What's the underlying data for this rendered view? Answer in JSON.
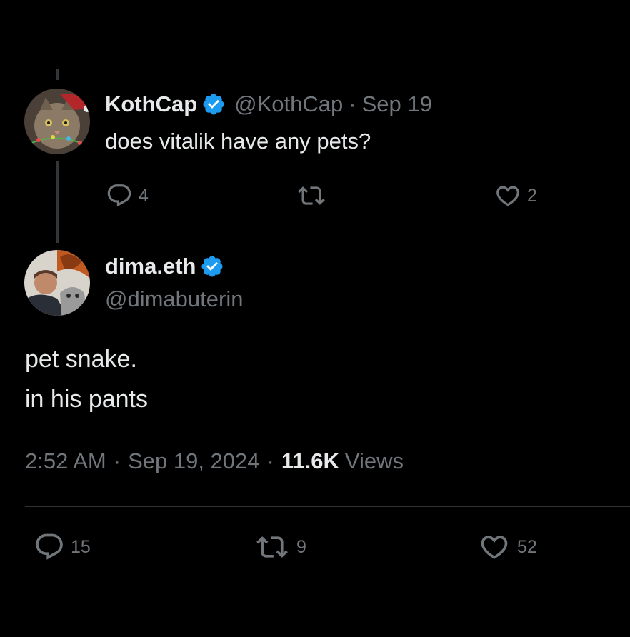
{
  "parent_tweet": {
    "display_name": "KothCap",
    "handle": "@KothCap",
    "separator": "·",
    "date": "Sep 19",
    "text": "does vitalik have any pets?",
    "actions": {
      "reply_count": "4",
      "retweet_count": "",
      "like_count": "2"
    },
    "verified": true
  },
  "main_tweet": {
    "display_name": "dima.eth",
    "handle": "@dimabuterin",
    "text_lines": [
      "pet snake.",
      "in his pants"
    ],
    "time": "2:52 AM",
    "separator_1": "·",
    "date": "Sep 19, 2024",
    "separator_2": "·",
    "views_count": "11.6K",
    "views_label": "Views",
    "actions": {
      "reply_count": "15",
      "retweet_count": "9",
      "like_count": "52"
    },
    "verified": true
  },
  "colors": {
    "background": "#000000",
    "primary_text": "#e7e9ea",
    "secondary_text": "#71767b",
    "verified_blue": "#1d9bf0",
    "divider": "#2f3336"
  },
  "icons": {
    "reply": "speech-bubble-icon",
    "retweet": "retweet-arrows-icon",
    "like": "heart-icon",
    "verified": "verified-badge-icon"
  }
}
